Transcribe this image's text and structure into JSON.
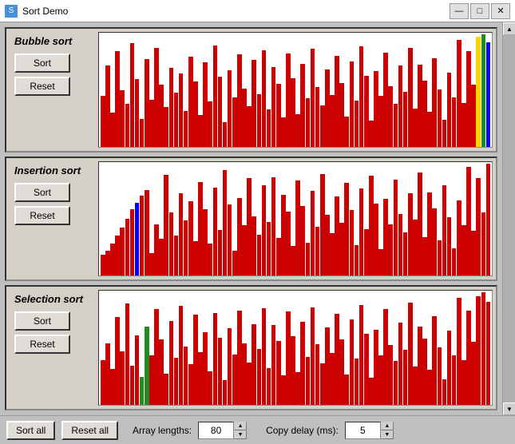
{
  "window": {
    "title": "Sort Demo",
    "min_btn": "—",
    "max_btn": "□",
    "close_btn": "✕"
  },
  "panels": [
    {
      "id": "bubble",
      "title": "Bubble sort",
      "sort_label": "Sort",
      "reset_label": "Reset",
      "bars": [
        45,
        72,
        30,
        85,
        50,
        38,
        92,
        60,
        25,
        78,
        42,
        88,
        55,
        35,
        70,
        48,
        65,
        32,
        80,
        58,
        28,
        75,
        40,
        90,
        62,
        22,
        68,
        44,
        82,
        52,
        36,
        77,
        47,
        86,
        33,
        71,
        56,
        26,
        83,
        61,
        29,
        74,
        43,
        87,
        53,
        37,
        69,
        46,
        81,
        57,
        27,
        76,
        41,
        89,
        63,
        23,
        67,
        45,
        84,
        54,
        38,
        72,
        49,
        88,
        34,
        73,
        59,
        31,
        79,
        51,
        24,
        66,
        44,
        95,
        39,
        85,
        55,
        98,
        100,
        93
      ],
      "special_bars": [
        {
          "index": 77,
          "color": "#ffd700"
        },
        {
          "index": 78,
          "color": "#228B22"
        },
        {
          "index": 79,
          "color": "#0000ff"
        }
      ]
    },
    {
      "id": "insertion",
      "title": "Insertion sort",
      "sort_label": "Sort",
      "reset_label": "Reset",
      "bars": [
        18,
        22,
        28,
        35,
        42,
        50,
        58,
        64,
        70,
        75,
        20,
        45,
        32,
        88,
        55,
        35,
        72,
        48,
        65,
        30,
        82,
        58,
        28,
        77,
        40,
        92,
        62,
        22,
        68,
        44,
        85,
        52,
        36,
        79,
        47,
        86,
        33,
        71,
        56,
        26,
        83,
        61,
        29,
        74,
        43,
        89,
        53,
        37,
        69,
        46,
        81,
        57,
        27,
        76,
        41,
        87,
        63,
        23,
        67,
        45,
        84,
        54,
        38,
        72,
        49,
        90,
        34,
        73,
        59,
        31,
        79,
        51,
        24,
        66,
        44,
        95,
        39,
        85,
        55,
        98
      ],
      "special_bars": [
        {
          "index": 7,
          "color": "#0000ff"
        }
      ]
    },
    {
      "id": "selection",
      "title": "Selection sort",
      "sort_label": "Sort",
      "reset_label": "Reset",
      "bars": [
        40,
        55,
        32,
        78,
        48,
        90,
        35,
        62,
        25,
        70,
        44,
        85,
        58,
        28,
        75,
        42,
        88,
        52,
        36,
        80,
        47,
        65,
        30,
        82,
        60,
        22,
        68,
        45,
        84,
        55,
        38,
        72,
        50,
        86,
        33,
        71,
        57,
        26,
        83,
        61,
        29,
        74,
        43,
        87,
        54,
        37,
        69,
        46,
        81,
        58,
        27,
        76,
        41,
        89,
        63,
        24,
        67,
        44,
        85,
        53,
        39,
        73,
        49,
        91,
        34,
        70,
        59,
        31,
        79,
        51,
        23,
        66,
        44,
        95,
        40,
        84,
        56,
        97,
        100,
        92
      ],
      "special_bars": [
        {
          "index": 8,
          "color": "#228B22"
        },
        {
          "index": 9,
          "color": "#228B22"
        }
      ]
    }
  ],
  "bottom": {
    "sort_all_label": "Sort all",
    "reset_all_label": "Reset all",
    "array_lengths_label": "Array lengths:",
    "array_lengths_value": "80",
    "copy_delay_label": "Copy delay (ms):",
    "copy_delay_value": "5"
  }
}
